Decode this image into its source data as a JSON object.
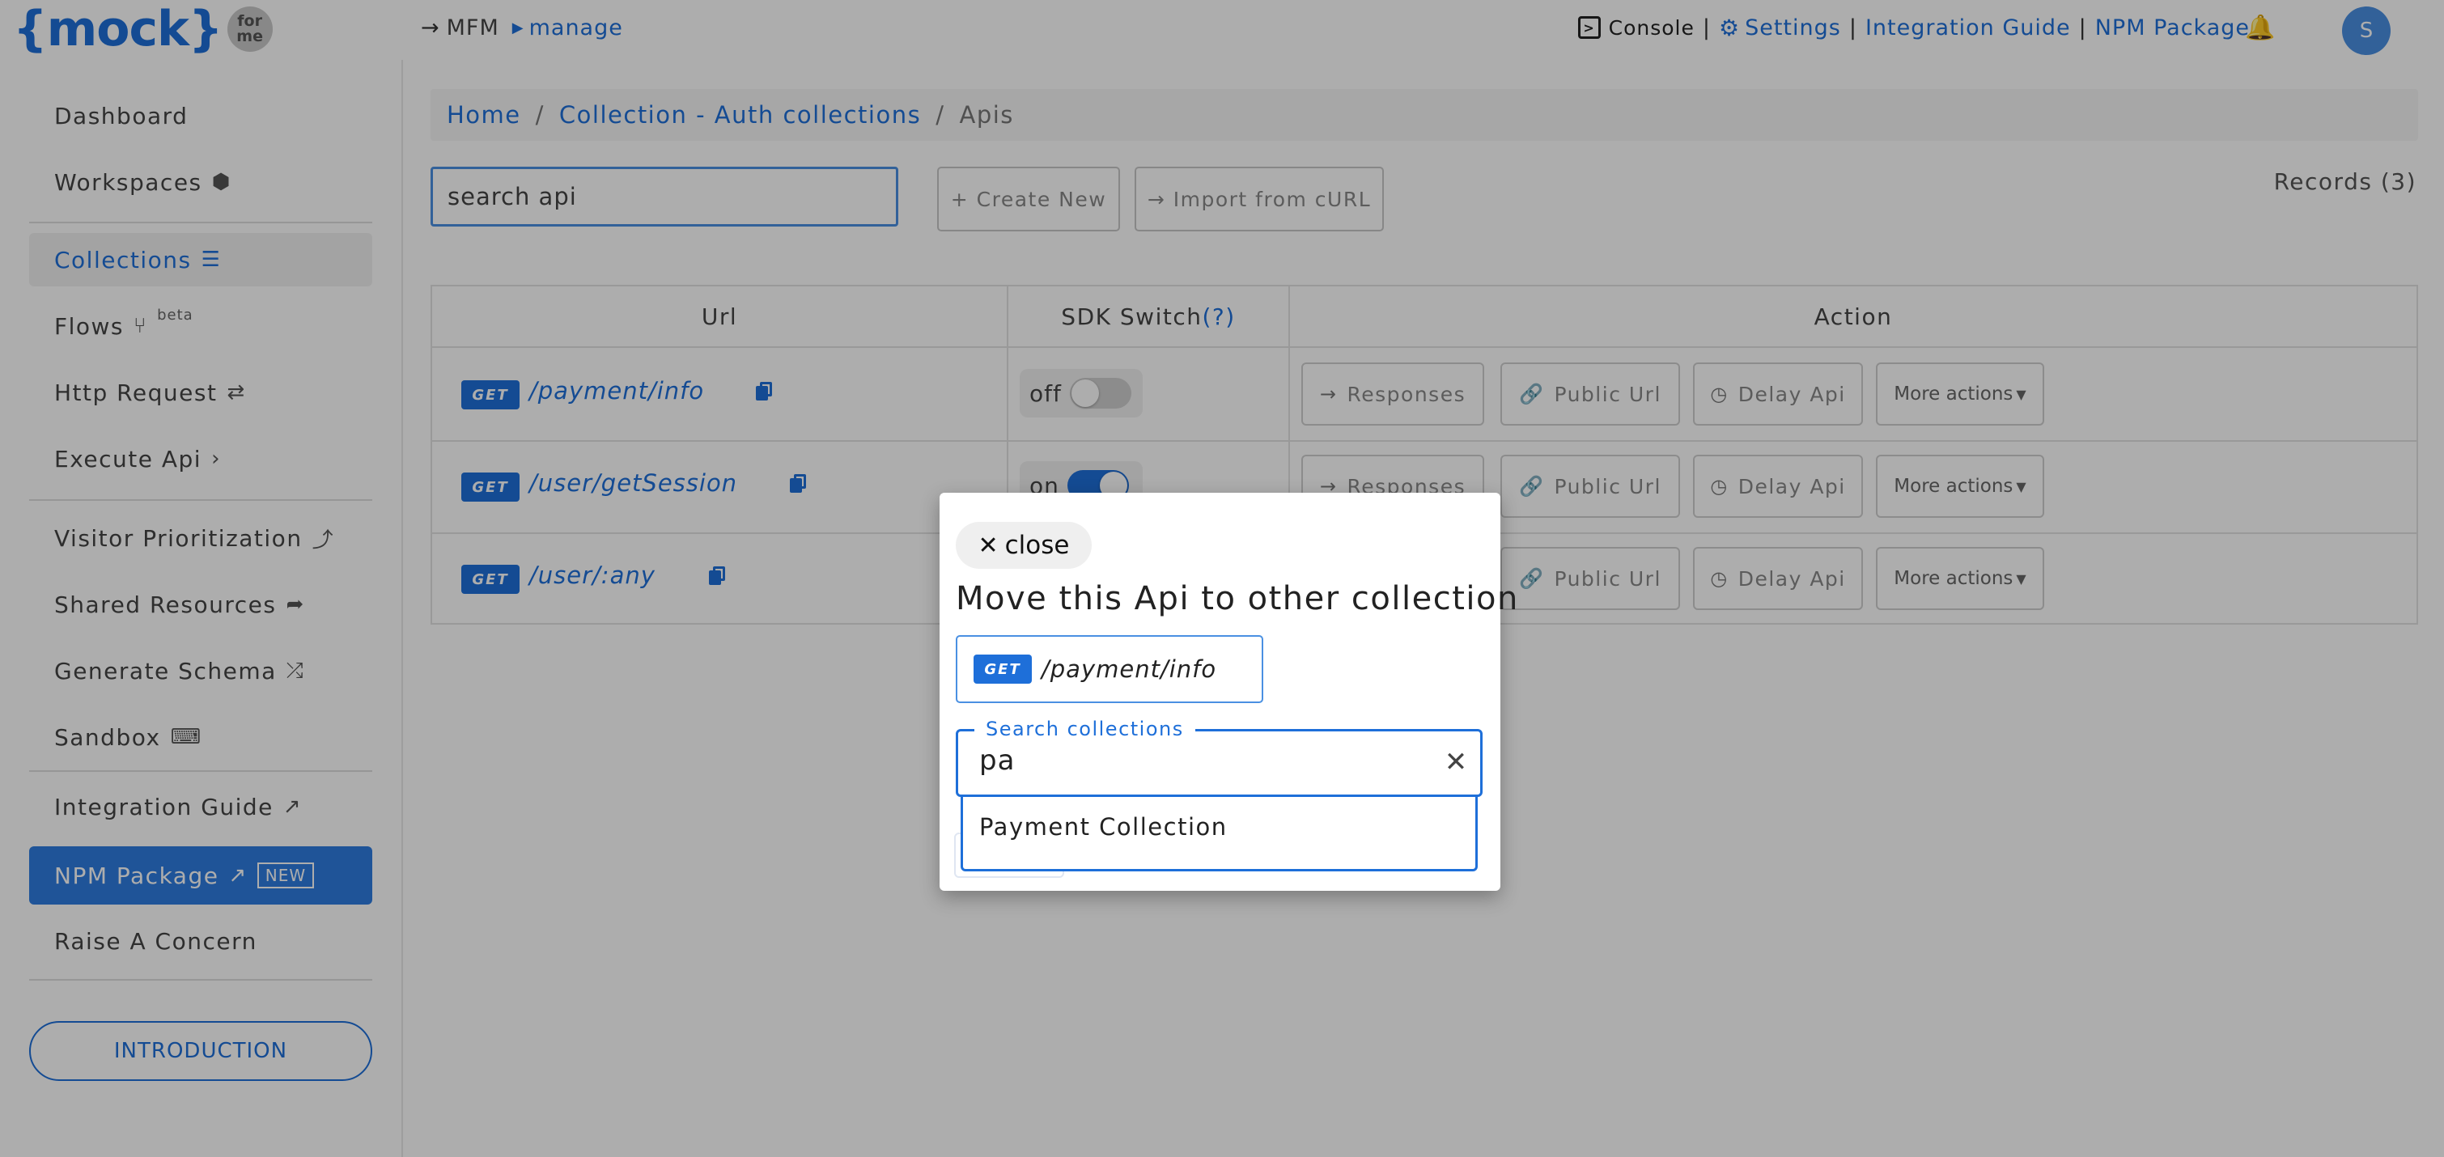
{
  "logo": {
    "text": "{mock}",
    "badge_line1": "for",
    "badge_line2": "me"
  },
  "topbar": {
    "crumb_root": "MFM",
    "crumb_current": "manage",
    "console": "Console",
    "settings": "Settings",
    "integration_guide": "Integration Guide",
    "npm_package": "NPM Package",
    "avatar_initial": "S"
  },
  "sidebar": {
    "dashboard": "Dashboard",
    "workspaces": "Workspaces",
    "collections": "Collections",
    "flows": "Flows",
    "flows_badge": "beta",
    "http_request": "Http Request",
    "execute_api": "Execute Api",
    "visitor_prioritization": "Visitor Prioritization",
    "shared_resources": "Shared Resources",
    "generate_schema": "Generate Schema",
    "sandbox": "Sandbox",
    "integration_guide": "Integration Guide",
    "npm_package": "NPM Package",
    "npm_badge": "NEW",
    "raise_concern": "Raise A Concern",
    "introduction": "INTRODUCTION"
  },
  "breadcrumb": {
    "home": "Home",
    "collection": "Collection - Auth collections",
    "current": "Apis"
  },
  "toolbar": {
    "search_value": "search api",
    "create_new": "+ Create New",
    "import_curl": "→ Import from cURL",
    "records": "Records (3)"
  },
  "table": {
    "headers": {
      "url": "Url",
      "sdk_switch": "SDK Switch",
      "sdk_help": "(?)",
      "action": "Action"
    },
    "rows": [
      {
        "method": "GET",
        "url": "/payment/info",
        "sdk_label": "off",
        "sdk_on": false
      },
      {
        "method": "GET",
        "url": "/user/getSession",
        "sdk_label": "on",
        "sdk_on": true
      },
      {
        "method": "GET",
        "url": "/user/:any",
        "sdk_label": "",
        "sdk_on": false
      }
    ],
    "actions": {
      "responses": "Responses",
      "public_url": "Public Url",
      "delay_api": "Delay Api",
      "more_actions": "More actions"
    }
  },
  "modal": {
    "close_label": "close",
    "title": "Move this Api to other collection",
    "api_method": "GET",
    "api_url": "/payment/info",
    "search_label": "Search collections",
    "search_value": "pa",
    "options": [
      "Payment Collection"
    ]
  },
  "colors": {
    "accent": "#1e6fd9",
    "overlay": "rgba(0,0,0,0.32)",
    "npm_active": "#2f7de1"
  }
}
